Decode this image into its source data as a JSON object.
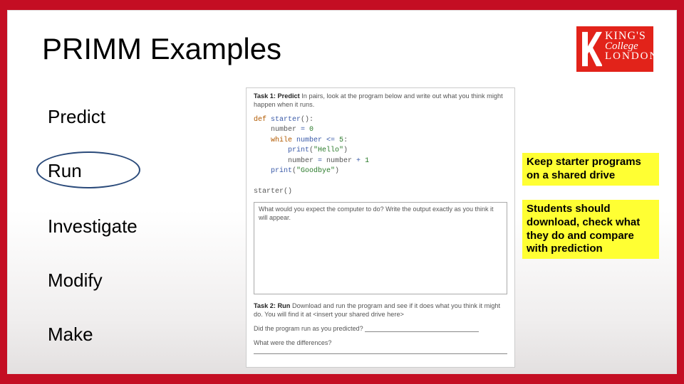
{
  "title": "PRIMM Examples",
  "logo": {
    "line1": "KING'S",
    "line2": "College",
    "line3": "LONDON"
  },
  "stages": {
    "s1": "Predict",
    "s2": "Run",
    "s3": "Investigate",
    "s4": "Modify",
    "s5": "Make"
  },
  "notes": {
    "n1": "Keep starter programs on a shared drive",
    "n2": "Students should download, check what they do and compare with prediction"
  },
  "worksheet": {
    "task1_label": "Task 1: Predict",
    "task1_text": " In pairs, look at the program below and write out what you think might happen when it runs.",
    "code": {
      "l1a": "def",
      "l1b": " starter",
      "l1c": "():",
      "l2a": "    number ",
      "l2b": "=",
      "l2c": " 0",
      "l3a": "    while ",
      "l3b": "number ",
      "l3c": "<=",
      "l3d": " 5",
      "l3e": ":",
      "l4a": "        print",
      "l4b": "(",
      "l4c": "\"Hello\"",
      "l4d": ")",
      "l5a": "        number ",
      "l5b": "=",
      "l5c": " number ",
      "l5d": "+",
      "l5e": " 1",
      "l6a": "    print",
      "l6b": "(",
      "l6c": "\"Goodbye\"",
      "l6d": ")",
      "l7": "starter()"
    },
    "qbox": "What would you expect the computer to do? Write the output exactly as you think it will appear.",
    "task2_label": "Task 2: Run",
    "task2_text": " Download and run the program and see if it does what you think it might do. You will find it at <insert your shared drive here>",
    "q1": "Did the program run as you predicted? ",
    "q2": "What were the differences? "
  }
}
